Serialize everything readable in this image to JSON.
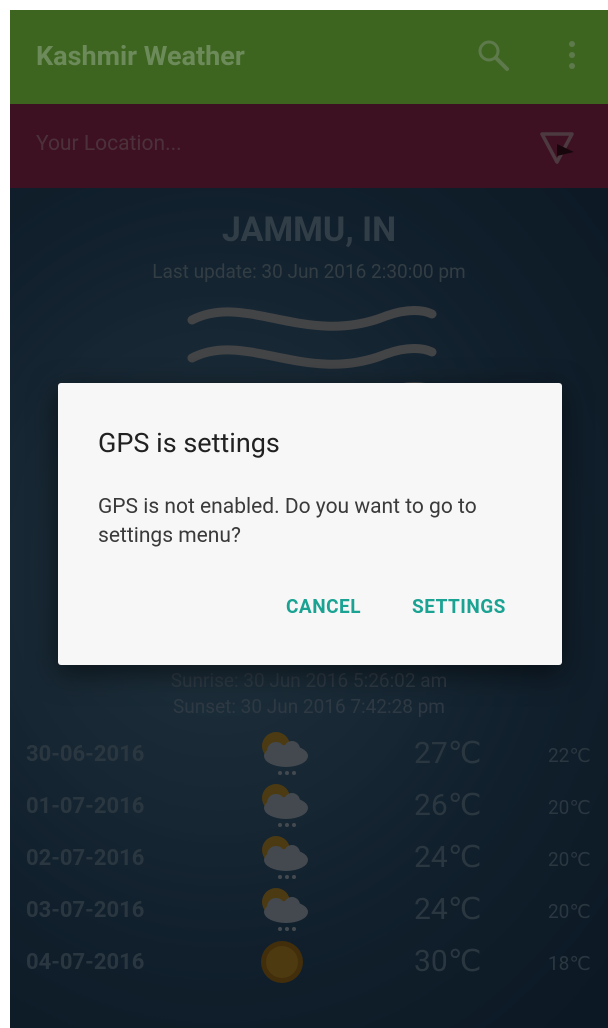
{
  "appbar": {
    "title": "Kashmir Weather",
    "search_icon": "search-icon",
    "menu_icon": "more-vert-icon"
  },
  "location_bar": {
    "placeholder": "Your Location...",
    "icon": "location-filter-icon"
  },
  "weather": {
    "city": "JAMMU, IN",
    "last_update": "Last update: 30 Jun 2016 2:30:00 pm",
    "icon": "wind-icon",
    "sunrise": "Sunrise: 30 Jun 2016 5:26:02 am",
    "sunset": "Sunset: 30 Jun 2016 7:42:28 pm"
  },
  "forecast": [
    {
      "date": "30-06-2016",
      "icon": "cloud-rain-sun-icon",
      "max": "27℃",
      "min": "22℃"
    },
    {
      "date": "01-07-2016",
      "icon": "cloud-rain-sun-icon",
      "max": "26℃",
      "min": "20℃"
    },
    {
      "date": "02-07-2016",
      "icon": "cloud-rain-sun-icon",
      "max": "24℃",
      "min": "20℃"
    },
    {
      "date": "03-07-2016",
      "icon": "cloud-rain-sun-icon",
      "max": "24℃",
      "min": "20℃"
    },
    {
      "date": "04-07-2016",
      "icon": "sun-icon",
      "max": "30℃",
      "min": "18℃"
    }
  ],
  "dialog": {
    "title": "GPS is settings",
    "message": "GPS is not enabled. Do you want to go to settings menu?",
    "cancel_label": "CANCEL",
    "settings_label": "SETTINGS"
  },
  "colors": {
    "appbar": "#3d6520",
    "location_bar": "#70203e",
    "accent": "#1aa293"
  }
}
